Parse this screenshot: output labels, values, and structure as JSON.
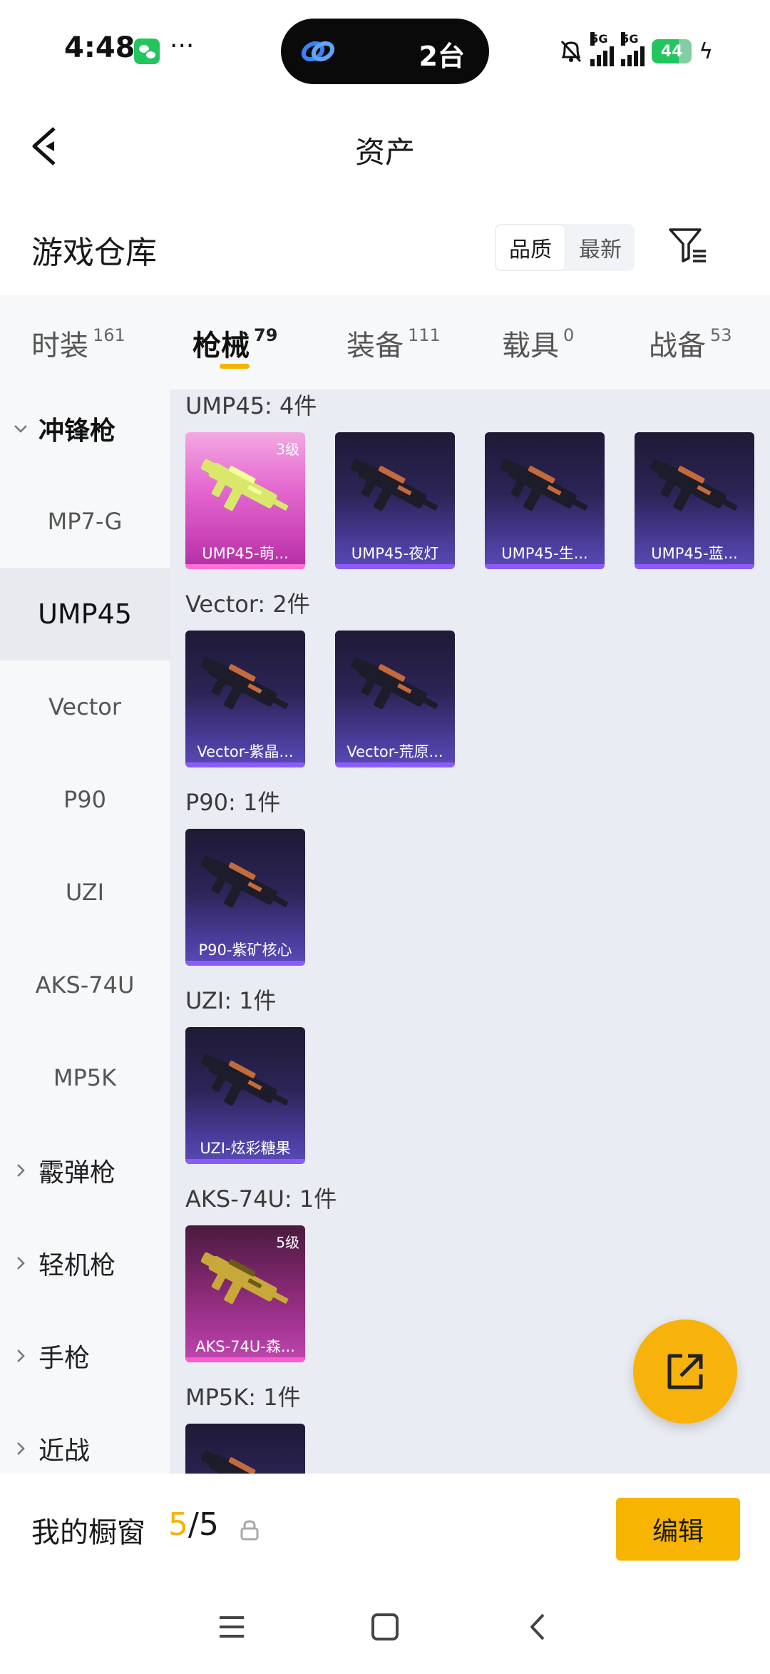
{
  "status_bar": {
    "time": "4:48",
    "more": "···",
    "island_count": "2台",
    "battery": "44",
    "network": "5G"
  },
  "header": {
    "title": "资产"
  },
  "warehouse": {
    "title": "游戏仓库",
    "sort_options": [
      "品质",
      "最新"
    ],
    "sort_active": "品质"
  },
  "tabs": [
    {
      "label": "时装",
      "count": "161"
    },
    {
      "label": "枪械",
      "count": "79",
      "active": true
    },
    {
      "label": "装备",
      "count": "111"
    },
    {
      "label": "载具",
      "count": "0"
    },
    {
      "label": "战备",
      "count": "53"
    }
  ],
  "sidebar": {
    "open_category": "冲锋枪",
    "sub_items": [
      "MP7-G",
      "UMP45",
      "Vector",
      "P90",
      "UZI",
      "AKS-74U",
      "MP5K"
    ],
    "active_sub": "UMP45",
    "categories": [
      "霰弹枪",
      "轻机枪",
      "手枪",
      "近战"
    ]
  },
  "groups": [
    {
      "label": "UMP45: 4件",
      "items": [
        {
          "name": "UMP45-萌...",
          "level": "3级",
          "style": "pink",
          "icon": "smg-icon"
        },
        {
          "name": "UMP45-夜灯",
          "style": "purple",
          "icon": "smg-icon"
        },
        {
          "name": "UMP45-生...",
          "style": "purple",
          "icon": "smg-icon"
        },
        {
          "name": "UMP45-蓝...",
          "style": "purple",
          "icon": "smg-icon"
        }
      ]
    },
    {
      "label": "Vector: 2件",
      "items": [
        {
          "name": "Vector-紫晶...",
          "style": "purple",
          "icon": "smg-icon"
        },
        {
          "name": "Vector-荒原...",
          "style": "purple",
          "icon": "smg-icon"
        }
      ]
    },
    {
      "label": "P90: 1件",
      "items": [
        {
          "name": "P90-紫矿核心",
          "style": "purple",
          "icon": "smg-icon"
        }
      ]
    },
    {
      "label": "UZI: 1件",
      "items": [
        {
          "name": "UZI-炫彩糖果",
          "style": "purple",
          "icon": "smg-icon"
        }
      ]
    },
    {
      "label": "AKS-74U: 1件",
      "items": [
        {
          "name": "AKS-74U-森...",
          "level": "5级",
          "style": "magenta",
          "icon": "rifle-icon"
        }
      ]
    },
    {
      "label": "MP5K: 1件",
      "items": [
        {
          "name": "",
          "style": "purple",
          "icon": "smg-icon"
        }
      ]
    }
  ],
  "showcase": {
    "label": "我的橱窗",
    "current": "5",
    "separator": "/",
    "total": "5",
    "edit_label": "编辑"
  },
  "colors": {
    "accent": "#f5b400",
    "rare_purple": "#5a4ab8",
    "legend_pink": "#e56ad0"
  }
}
